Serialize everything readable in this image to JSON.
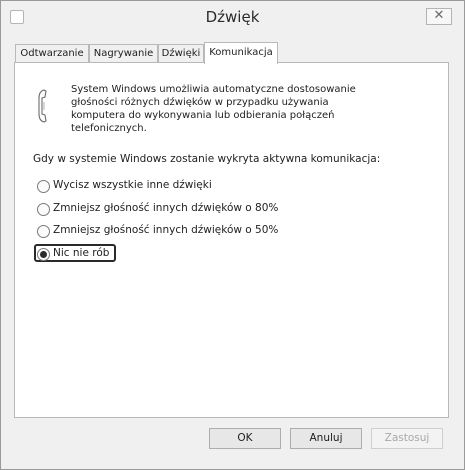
{
  "window": {
    "title": "Dźwięk"
  },
  "title_bar": {
    "close_glyph": "✕"
  },
  "tabs": [
    {
      "label": "Odtwarzanie"
    },
    {
      "label": "Nagrywanie"
    },
    {
      "label": "Dźwięki"
    },
    {
      "label": "Komunikacja"
    }
  ],
  "active_tab": "Komunikacja",
  "communication": {
    "icon": "phone-handset-icon",
    "description_lines": [
      "System Windows umożliwia automatyczne dostosowanie",
      "głośności różnych dźwięków w przypadku używania",
      "komputera do wykonywania lub odbierania połączeń",
      "telefonicznych."
    ],
    "prompt": "Gdy w systemie Windows zostanie wykryta aktywna komunikacja:",
    "options": [
      {
        "label": "Wycisz wszystkie inne dźwięki",
        "checked": false
      },
      {
        "label": "Zmniejsz głośność innych dźwięków o 80%",
        "checked": false
      },
      {
        "label": "Zmniejsz głośność innych dźwięków o 50%",
        "checked": false
      },
      {
        "label": "Nic nie rób",
        "checked": true
      }
    ]
  },
  "buttons": {
    "ok": "OK",
    "cancel": "Anuluj",
    "apply": "Zastosuj"
  }
}
